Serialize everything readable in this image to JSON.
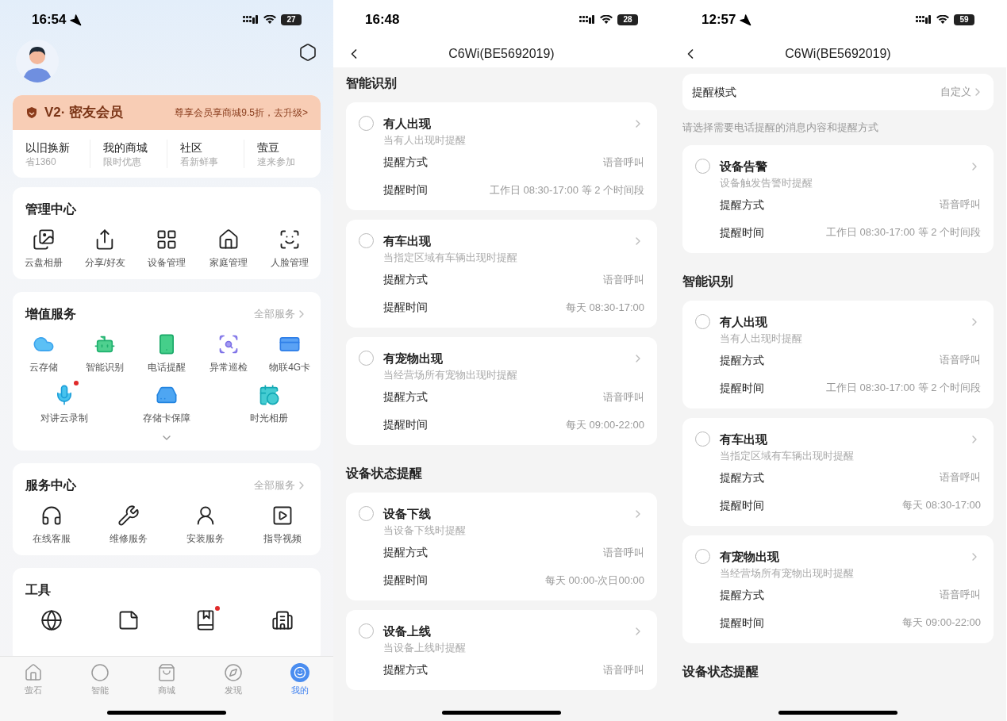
{
  "profile_screen": {
    "status_bar": {
      "time": "16:54",
      "location": true,
      "battery": "27"
    },
    "membership": {
      "title": "V2· 密友会员",
      "offer": "尊享会员享商城9.5折，去升级>"
    },
    "quick_links": [
      {
        "title": "以旧换新",
        "subtitle": "省1360"
      },
      {
        "title": "我的商城",
        "subtitle": "限时优惠"
      },
      {
        "title": "社区",
        "subtitle": "看新鲜事"
      },
      {
        "title": "萤豆",
        "subtitle": "速来参加"
      }
    ],
    "management": {
      "title": "管理中心",
      "items": [
        {
          "kind": "album",
          "label": "云盘相册"
        },
        {
          "kind": "share",
          "label": "分享/好友"
        },
        {
          "kind": "devices",
          "label": "设备管理"
        },
        {
          "kind": "home",
          "label": "家庭管理"
        },
        {
          "kind": "face",
          "label": "人脸管理"
        }
      ]
    },
    "value_added": {
      "title": "增值服务",
      "more": "全部服务",
      "items": [
        {
          "kind": "cloud",
          "label": "云存储",
          "badge": false
        },
        {
          "kind": "ai",
          "label": "智能识别",
          "badge": false
        },
        {
          "kind": "phone",
          "label": "电话提醒",
          "badge": false
        },
        {
          "kind": "patrol",
          "label": "异常巡检",
          "badge": false
        },
        {
          "kind": "sim",
          "label": "物联4G卡",
          "badge": false
        },
        {
          "kind": "mic",
          "label": "对讲云录制",
          "badge": true
        },
        {
          "kind": "sd",
          "label": "存储卡保障",
          "badge": false
        },
        {
          "kind": "calendar",
          "label": "时光相册",
          "badge": false
        }
      ]
    },
    "service_center": {
      "title": "服务中心",
      "more": "全部服务",
      "items": [
        {
          "kind": "headset",
          "label": "在线客服"
        },
        {
          "kind": "wrench",
          "label": "维修服务"
        },
        {
          "kind": "worker",
          "label": "安装服务"
        },
        {
          "kind": "video",
          "label": "指导视频"
        }
      ]
    },
    "tools": {
      "title": "工具",
      "items": [
        {
          "kind": "globe",
          "badge": false
        },
        {
          "kind": "note",
          "badge": false
        },
        {
          "kind": "book",
          "badge": true
        },
        {
          "kind": "building",
          "badge": false
        }
      ]
    },
    "tab_bar": [
      {
        "kind": "home",
        "label": "萤石",
        "selected": false
      },
      {
        "kind": "smart",
        "label": "智能",
        "selected": false
      },
      {
        "kind": "shop",
        "label": "商城",
        "selected": false
      },
      {
        "kind": "discover",
        "label": "发现",
        "selected": false
      },
      {
        "kind": "me",
        "label": "我的",
        "selected": true
      }
    ]
  },
  "alert_screens": [
    {
      "status_bar": {
        "time": "16:48",
        "location": false,
        "battery": "28"
      },
      "title": "C6Wi(BE5692019)",
      "sections": [
        {
          "heading": "智能识别",
          "items": [
            {
              "title": "有人出现",
              "subtitle": "当有人出现时提醒",
              "checked": false,
              "rows": [
                {
                  "label": "提醒方式",
                  "value": "语音呼叫"
                },
                {
                  "label": "提醒时间",
                  "value": "工作日 08:30-17:00 等 2 个时间段"
                }
              ]
            },
            {
              "title": "有车出现",
              "subtitle": "当指定区域有车辆出现时提醒",
              "checked": false,
              "rows": [
                {
                  "label": "提醒方式",
                  "value": "语音呼叫"
                },
                {
                  "label": "提醒时间",
                  "value": "每天 08:30-17:00"
                }
              ]
            },
            {
              "title": "有宠物出现",
              "subtitle": "当经营场所有宠物出现时提醒",
              "checked": false,
              "rows": [
                {
                  "label": "提醒方式",
                  "value": "语音呼叫"
                },
                {
                  "label": "提醒时间",
                  "value": "每天 09:00-22:00"
                }
              ]
            }
          ]
        },
        {
          "heading": "设备状态提醒",
          "items": [
            {
              "title": "设备下线",
              "subtitle": "当设备下线时提醒",
              "checked": false,
              "rows": [
                {
                  "label": "提醒方式",
                  "value": "语音呼叫"
                },
                {
                  "label": "提醒时间",
                  "value": "每天 00:00-次日00:00"
                }
              ]
            },
            {
              "title": "设备上线",
              "subtitle": "当设备上线时提醒",
              "checked": false,
              "rows": [
                {
                  "label": "提醒方式",
                  "value": "语音呼叫"
                }
              ]
            }
          ]
        }
      ]
    },
    {
      "status_bar": {
        "time": "12:57",
        "location": true,
        "battery": "59"
      },
      "title": "C6Wi(BE5692019)",
      "mode": {
        "label": "提醒模式",
        "value": "自定义"
      },
      "hint": "请选择需要电话提醒的消息内容和提醒方式",
      "sections": [
        {
          "items": [
            {
              "title": "设备告警",
              "subtitle": "设备触发告警时提醒",
              "checked": false,
              "rows": [
                {
                  "label": "提醒方式",
                  "value": "语音呼叫"
                },
                {
                  "label": "提醒时间",
                  "value": "工作日 08:30-17:00 等 2 个时间段"
                }
              ]
            }
          ]
        },
        {
          "heading": "智能识别",
          "items": [
            {
              "title": "有人出现",
              "subtitle": "当有人出现时提醒",
              "checked": false,
              "rows": [
                {
                  "label": "提醒方式",
                  "value": "语音呼叫"
                },
                {
                  "label": "提醒时间",
                  "value": "工作日 08:30-17:00 等 2 个时间段"
                }
              ]
            },
            {
              "title": "有车出现",
              "subtitle": "当指定区域有车辆出现时提醒",
              "checked": false,
              "rows": [
                {
                  "label": "提醒方式",
                  "value": "语音呼叫"
                },
                {
                  "label": "提醒时间",
                  "value": "每天 08:30-17:00"
                }
              ]
            },
            {
              "title": "有宠物出现",
              "subtitle": "当经营场所有宠物出现时提醒",
              "checked": false,
              "rows": [
                {
                  "label": "提醒方式",
                  "value": "语音呼叫"
                },
                {
                  "label": "提醒时间",
                  "value": "每天 09:00-22:00"
                }
              ]
            }
          ]
        },
        {
          "heading": "设备状态提醒"
        }
      ]
    }
  ]
}
